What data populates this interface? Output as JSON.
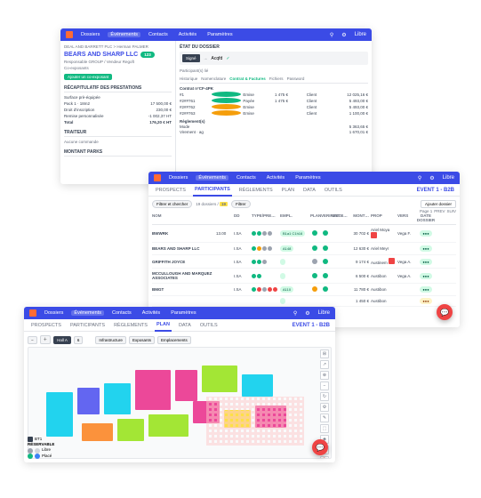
{
  "colors": {
    "primary": "#3b4be6",
    "accent": "#ff6b35",
    "green": "#10b981",
    "orange": "#f59e0b",
    "red": "#ef4444"
  },
  "topnav": {
    "items": [
      "Dossiers",
      "Événements",
      "Contacts",
      "Activités",
      "Paramètres"
    ],
    "right_label": "Libre"
  },
  "w1": {
    "breadcrumb": "DEAL AND BARRETT PLC  >  Herman PALMER",
    "title": "BEARS AND SHARP LLC",
    "title_badge": "123",
    "responsable_label": "Responsable GROUP / Vendeur Regoft",
    "co_exposants_label": "Co-exposants",
    "co_exp_chip": "Ajouter un co-exposant",
    "section_recap": "RÉCAPITULATIF DES PRESTATIONS",
    "recap_rows": [
      {
        "label": "Surface prè-équipée",
        "value": ""
      },
      {
        "label": "Pack 1 · 18m2",
        "value": "17 500,00 €"
      },
      {
        "label": "Droit d'inscription",
        "value": "230,00 €"
      },
      {
        "label": "Remise personnalisée",
        "value": "-1 002,37 HT"
      },
      {
        "label": "Total",
        "value": "176,20 € HT"
      }
    ],
    "section_traiteur": "TRAITEUR",
    "traiteur_text": "Aucune commande",
    "section_montant": "MONTANT PARKS",
    "etat_title": "ÉTAT DU DOSSIER",
    "etat_blk": "Signé",
    "etat_next": "Acqfd",
    "etat_participants": "Participant(s) lié",
    "tabs": [
      "Historique",
      "Nomenclature",
      "Contrat & Factures",
      "Fichiers",
      "Password"
    ],
    "contract_header": "Contrat n°CF-4PK",
    "contract_rows": [
      {
        "c1": "#1",
        "c2": "Type",
        "c3": "Emise",
        "c4": "1 475 €",
        "c5": "Client",
        "c6": "",
        "c7": "12 025,16 €"
      },
      {
        "c1": "#2##761",
        "c2": "Acompte",
        "c3": "Payée",
        "c4": "1 475 €",
        "c5": "Client",
        "c6": "",
        "c7": "5 493,00 €"
      },
      {
        "c1": "#2##762",
        "c2": "Acompte",
        "c3": "Emise",
        "c4": "",
        "c5": "Client",
        "c6": "",
        "c7": "5 493,00 €"
      },
      {
        "c1": "#2##763",
        "c2": "Solde",
        "c3": "Emise",
        "c4": "",
        "c5": "Client",
        "c6": "",
        "c7": "1 100,00 €"
      }
    ],
    "reglement_header": "Règlement(s)",
    "reglement_rows": [
      {
        "c1": "Mode",
        "c2": "",
        "c3": "",
        "c4": "",
        "c5": "",
        "c6": "",
        "c7": "5 363,65 €"
      },
      {
        "c1": "Virement · ag",
        "c2": "",
        "c3": "",
        "c4": "",
        "c5": "",
        "c6": "",
        "c7": "1 670,01 €"
      }
    ]
  },
  "w2": {
    "tabs": [
      "PROSPECTS",
      "PARTICIPANTS",
      "RÈGLEMENTS",
      "PLAN",
      "DATA",
      "OUTILS"
    ],
    "active_tab": 1,
    "event_title": "EVENT 1 - B2B",
    "filter_label": "Filtrer et chercher",
    "count_prefix": "19  dossiers /",
    "count_highlight": "19",
    "count_action": "Filtrer",
    "add_btn": "Ajouter dossier",
    "pager_label": "Page 1",
    "pager_prev": "PREV",
    "pager_next": "SUIV",
    "columns": [
      "NOM",
      "",
      "DD",
      "TYPE/PRE…",
      "EMPL.",
      "PLAN",
      "VERIFEXTR…",
      "UNI…",
      "MONT…",
      "PROP",
      "VERS",
      "DATE DOSSIER"
    ],
    "rows": [
      {
        "name": "BWWRK",
        "num": "13.00",
        "dd": "I.SA",
        "typ": [
          "grn",
          "grn",
          "gry",
          "gry"
        ],
        "empl": "B1a1 C1h16",
        "plan": "grn",
        "v": "grn",
        "amt": "30 702 €",
        "user": "Ariel Moya",
        "sq": true,
        "vers": "Vega F.",
        "dos": "grn"
      },
      {
        "name": "BEARS AND SHARP LLC",
        "num": "",
        "dd": "I.SA",
        "typ": [
          "grn",
          "org",
          "gry",
          "gry"
        ],
        "empl": "A148",
        "plan": "grn",
        "v": "grn",
        "amt": "12 630 €",
        "user": "Ariel Meyr",
        "sq": false,
        "vers": "",
        "dos": "grn"
      },
      {
        "name": "GRIFFITH JOYCE",
        "num": "",
        "dd": "I.SA",
        "typ": [
          "grn",
          "grn",
          "gry"
        ],
        "empl": "",
        "plan": "gry",
        "v": "grn",
        "amt": "9 174 €",
        "user": "Austinem",
        "sq": true,
        "vers": "Vega A.",
        "dos": "grn"
      },
      {
        "name": "MCCULLOUGH AND MARQUEZ ASSOCIATES",
        "num": "",
        "dd": "I.SA",
        "typ": [
          "grn",
          "grn"
        ],
        "empl": "",
        "plan": "grn",
        "v": "grn",
        "amt": "6 500 €",
        "user": "Austibon",
        "sq": false,
        "vers": "Vega A.",
        "dos": "grn"
      },
      {
        "name": "BMGT",
        "num": "",
        "dd": "I.SA",
        "typ": [
          "grn",
          "red",
          "gry",
          "red",
          "red"
        ],
        "empl": "A110",
        "plan": "org",
        "v": "grn",
        "amt": "11 780 €",
        "user": "Austibon",
        "sq": false,
        "vers": "",
        "dos": "grn"
      },
      {
        "name": "",
        "num": "",
        "dd": "",
        "typ": [],
        "empl": "",
        "plan": "",
        "v": "",
        "amt": "1 450 €",
        "user": "Austibon",
        "sq": false,
        "vers": "",
        "dos": "org"
      }
    ]
  },
  "w3": {
    "tabs": [
      "PROSPECTS",
      "PARTICIPANTS",
      "RÈGLEMENTS",
      "PLAN",
      "DATA",
      "OUTILS"
    ],
    "active_tab": 3,
    "event_title": "EVENT 1 - B2B",
    "toolbar": {
      "hall": "Hall A",
      "count": "6",
      "layers": [
        "Infrastructure",
        "Exposants",
        "Emplacements"
      ]
    },
    "legend": [
      {
        "label": "BT1",
        "box": "#374151"
      },
      {
        "label": "RÉSERVABLE",
        "box": ""
      },
      {
        "label": "Libre",
        "dots": [
          "#d1d5db",
          "#9ca3af"
        ]
      },
      {
        "label": "Placé",
        "dots": [
          "#10b981",
          "#3b82f6"
        ]
      }
    ],
    "side_tools": [
      "⊞",
      "↗",
      "⊕",
      "−",
      "↻",
      "⚙",
      "✎",
      "⬚",
      "◈",
      "☰",
      "📍"
    ]
  }
}
